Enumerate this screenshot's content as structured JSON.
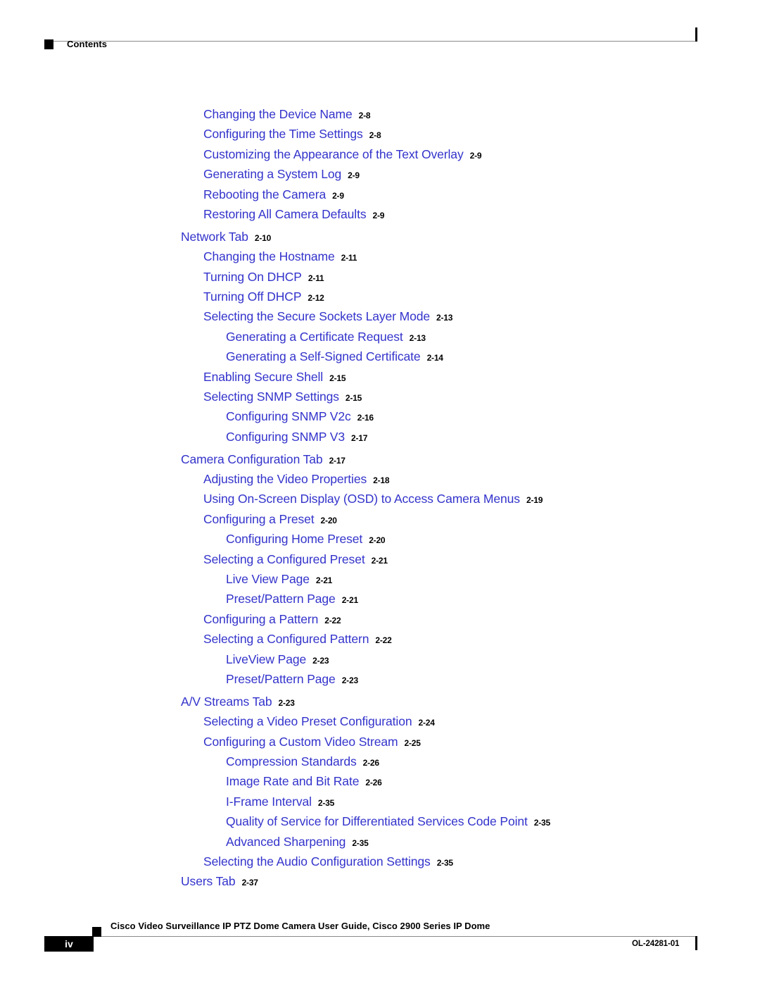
{
  "header": {
    "title": "Contents"
  },
  "toc": {
    "entries": [
      {
        "title": "Changing the Device Name",
        "page": "2-8",
        "level": 2,
        "gap_before": false
      },
      {
        "title": "Configuring the Time Settings",
        "page": "2-8",
        "level": 2,
        "gap_before": false
      },
      {
        "title": "Customizing the Appearance of the Text Overlay",
        "page": "2-9",
        "level": 2,
        "gap_before": false
      },
      {
        "title": "Generating a System Log",
        "page": "2-9",
        "level": 2,
        "gap_before": false
      },
      {
        "title": "Rebooting the Camera",
        "page": "2-9",
        "level": 2,
        "gap_before": false
      },
      {
        "title": "Restoring All Camera Defaults",
        "page": "2-9",
        "level": 2,
        "gap_before": false
      },
      {
        "title": "Network Tab",
        "page": "2-10",
        "level": 1,
        "gap_before": true
      },
      {
        "title": "Changing the Hostname",
        "page": "2-11",
        "level": 2,
        "gap_before": false
      },
      {
        "title": "Turning On DHCP",
        "page": "2-11",
        "level": 2,
        "gap_before": false
      },
      {
        "title": "Turning Off DHCP",
        "page": "2-12",
        "level": 2,
        "gap_before": false
      },
      {
        "title": "Selecting the Secure Sockets Layer Mode",
        "page": "2-13",
        "level": 2,
        "gap_before": false
      },
      {
        "title": "Generating a Certificate Request",
        "page": "2-13",
        "level": 3,
        "gap_before": false
      },
      {
        "title": "Generating a Self-Signed Certificate",
        "page": "2-14",
        "level": 3,
        "gap_before": false
      },
      {
        "title": "Enabling Secure Shell",
        "page": "2-15",
        "level": 2,
        "gap_before": false
      },
      {
        "title": "Selecting SNMP Settings",
        "page": "2-15",
        "level": 2,
        "gap_before": false
      },
      {
        "title": "Configuring SNMP V2c",
        "page": "2-16",
        "level": 3,
        "gap_before": false
      },
      {
        "title": "Configuring SNMP V3",
        "page": "2-17",
        "level": 3,
        "gap_before": false
      },
      {
        "title": "Camera Configuration Tab",
        "page": "2-17",
        "level": 1,
        "gap_before": true
      },
      {
        "title": "Adjusting the Video Properties",
        "page": "2-18",
        "level": 2,
        "gap_before": false
      },
      {
        "title": "Using On-Screen Display (OSD) to Access Camera Menus",
        "page": "2-19",
        "level": 2,
        "gap_before": false
      },
      {
        "title": "Configuring a Preset",
        "page": "2-20",
        "level": 2,
        "gap_before": false
      },
      {
        "title": "Configuring Home Preset",
        "page": "2-20",
        "level": 3,
        "gap_before": false
      },
      {
        "title": "Selecting a Configured Preset",
        "page": "2-21",
        "level": 2,
        "gap_before": false
      },
      {
        "title": "Live View Page",
        "page": "2-21",
        "level": 3,
        "gap_before": false
      },
      {
        "title": "Preset/Pattern Page",
        "page": "2-21",
        "level": 3,
        "gap_before": false
      },
      {
        "title": "Configuring a Pattern",
        "page": "2-22",
        "level": 2,
        "gap_before": false
      },
      {
        "title": "Selecting a Configured Pattern",
        "page": "2-22",
        "level": 2,
        "gap_before": false
      },
      {
        "title": "LiveView Page",
        "page": "2-23",
        "level": 3,
        "gap_before": false
      },
      {
        "title": "Preset/Pattern Page",
        "page": "2-23",
        "level": 3,
        "gap_before": false
      },
      {
        "title": "A/V Streams Tab",
        "page": "2-23",
        "level": 1,
        "gap_before": true
      },
      {
        "title": "Selecting a Video Preset Configuration",
        "page": "2-24",
        "level": 2,
        "gap_before": false
      },
      {
        "title": "Configuring a Custom Video Stream",
        "page": "2-25",
        "level": 2,
        "gap_before": false
      },
      {
        "title": "Compression Standards",
        "page": "2-26",
        "level": 3,
        "gap_before": false
      },
      {
        "title": "Image Rate and Bit Rate",
        "page": "2-26",
        "level": 3,
        "gap_before": false
      },
      {
        "title": "I-Frame Interval",
        "page": "2-35",
        "level": 3,
        "gap_before": false
      },
      {
        "title": "Quality of Service for Differentiated Services Code Point",
        "page": "2-35",
        "level": 3,
        "gap_before": false
      },
      {
        "title": "Advanced Sharpening",
        "page": "2-35",
        "level": 3,
        "gap_before": false
      },
      {
        "title": "Selecting the Audio Configuration Settings",
        "page": "2-35",
        "level": 2,
        "gap_before": false
      },
      {
        "title": "Users Tab",
        "page": "2-37",
        "level": 1,
        "gap_before": false
      }
    ]
  },
  "footer": {
    "page_number": "iv",
    "title": "Cisco Video Surveillance IP PTZ Dome Camera User Guide, Cisco 2900 Series IP Dome",
    "doc_number": "OL-24281-01"
  },
  "colors": {
    "link": "#3333CC",
    "text": "#000000",
    "rule": "#8A8A8A"
  }
}
